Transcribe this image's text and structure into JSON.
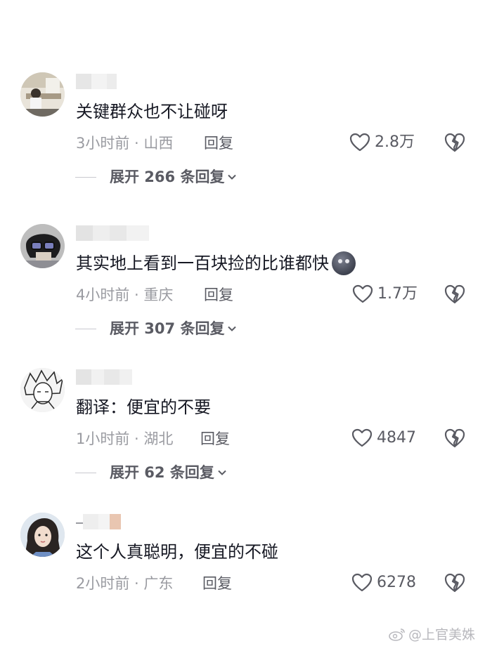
{
  "comments": [
    {
      "text": "关键群众也不让碰呀",
      "meta": "3小时前 · 山西",
      "reply_label": "回复",
      "likes": "2.8万",
      "expand_label": "展开 266 条回复"
    },
    {
      "text": "其实地上看到一百块捡的比谁都快",
      "meta": "4小时前 · 重庆",
      "reply_label": "回复",
      "likes": "1.7万",
      "expand_label": "展开 307 条回复"
    },
    {
      "text": "翻译：便宜的不要",
      "meta": "1小时前 · 湖北",
      "reply_label": "回复",
      "likes": "4847",
      "expand_label": "展开 62 条回复"
    },
    {
      "text": "这个人真聪明，便宜的不碰",
      "meta": "2小时前 · 广东",
      "reply_label": "回复",
      "likes": "6278",
      "expand_label": ""
    }
  ],
  "watermark": "@上官美姝",
  "icons": {
    "like": "heart-outline-icon",
    "dislike": "broken-heart-icon",
    "expand": "chevron-down-icon",
    "watermark": "weibo-icon"
  },
  "colors": {
    "text": "#161823",
    "meta": "#9a9ba1",
    "action": "#5a5b63",
    "background": "#ffffff"
  }
}
